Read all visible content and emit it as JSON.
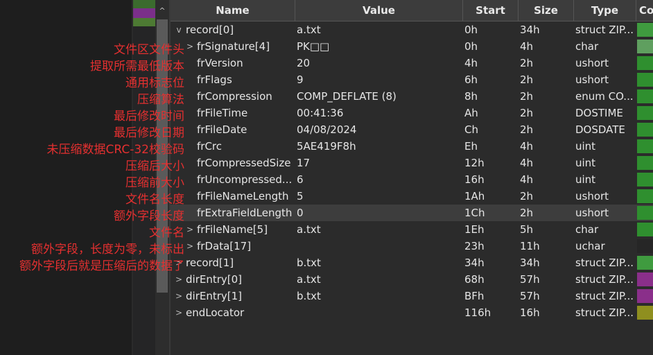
{
  "columns": {
    "name": "Name",
    "value": "Value",
    "start": "Start",
    "size": "Size",
    "type": "Type",
    "color": "Co"
  },
  "rows": [
    {
      "expander": "v",
      "name": "record[0]",
      "value": "a.txt",
      "start": "0h",
      "size": "34h",
      "type": "struct ZIP...",
      "swatch": "#3f9b3f"
    },
    {
      "expander": ">",
      "name": "frSignature[4]",
      "value": "PK□□",
      "start": "0h",
      "size": "4h",
      "type": "char",
      "swatch": "#5f9f5f"
    },
    {
      "expander": "",
      "name": "frVersion",
      "value": "20",
      "start": "4h",
      "size": "2h",
      "type": "ushort",
      "swatch": "#2f8f2f"
    },
    {
      "expander": "",
      "name": "frFlags",
      "value": "9",
      "start": "6h",
      "size": "2h",
      "type": "ushort",
      "swatch": "#2f8f2f"
    },
    {
      "expander": "",
      "name": "frCompression",
      "value": "COMP_DEFLATE (8)",
      "start": "8h",
      "size": "2h",
      "type": "enum CO...",
      "swatch": "#2f8f2f"
    },
    {
      "expander": "",
      "name": "frFileTime",
      "value": "00:41:36",
      "start": "Ah",
      "size": "2h",
      "type": "DOSTIME",
      "swatch": "#2f8f2f"
    },
    {
      "expander": "",
      "name": "frFileDate",
      "value": "04/08/2024",
      "start": "Ch",
      "size": "2h",
      "type": "DOSDATE",
      "swatch": "#2f8f2f"
    },
    {
      "expander": "",
      "name": "frCrc",
      "value": "5AE419F8h",
      "start": "Eh",
      "size": "4h",
      "type": "uint",
      "swatch": "#2f8f2f"
    },
    {
      "expander": "",
      "name": "frCompressedSize",
      "value": "17",
      "start": "12h",
      "size": "4h",
      "type": "uint",
      "swatch": "#2f8f2f"
    },
    {
      "expander": "",
      "name": "frUncompressed...",
      "value": "6",
      "start": "16h",
      "size": "4h",
      "type": "uint",
      "swatch": "#2f8f2f"
    },
    {
      "expander": "",
      "name": "frFileNameLength",
      "value": "5",
      "start": "1Ah",
      "size": "2h",
      "type": "ushort",
      "swatch": "#2f8f2f"
    },
    {
      "expander": "",
      "name": "frExtraFieldLength",
      "value": "0",
      "start": "1Ch",
      "size": "2h",
      "type": "ushort",
      "swatch": "#2f8f2f",
      "selected": true
    },
    {
      "expander": ">",
      "name": "frFileName[5]",
      "value": "a.txt",
      "start": "1Eh",
      "size": "5h",
      "type": "char",
      "swatch": "#2f8f2f"
    },
    {
      "expander": ">",
      "name": "frData[17]",
      "value": "",
      "start": "23h",
      "size": "11h",
      "type": "uchar",
      "swatch": "#262626"
    },
    {
      "expander": ">",
      "name": "record[1]",
      "value": "b.txt",
      "start": "34h",
      "size": "34h",
      "type": "struct ZIP...",
      "swatch": "#3f9b3f"
    },
    {
      "expander": ">",
      "name": "dirEntry[0]",
      "value": "a.txt",
      "start": "68h",
      "size": "57h",
      "type": "struct ZIP...",
      "swatch": "#8a2f8a"
    },
    {
      "expander": ">",
      "name": "dirEntry[1]",
      "value": "b.txt",
      "start": "BFh",
      "size": "57h",
      "type": "struct ZIP...",
      "swatch": "#8a2f8a"
    },
    {
      "expander": ">",
      "name": "endLocator",
      "value": "",
      "start": "116h",
      "size": "16h",
      "type": "struct ZIP...",
      "swatch": "#8f8f1f"
    }
  ],
  "annotations": [
    "文件区文件头",
    "提取所需最低版本",
    "通用标志位",
    "压缩算法",
    "最后修改时间",
    "最后修改日期",
    "未压缩数据CRC-32校验码",
    "压缩后大小",
    "压缩前大小",
    "文件名长度",
    "额外字段长度",
    "文件名",
    "额外字段，长度为零，未标出",
    "额外字段后就是压缩后的数据了"
  ],
  "scroll_up_glyph": "^"
}
